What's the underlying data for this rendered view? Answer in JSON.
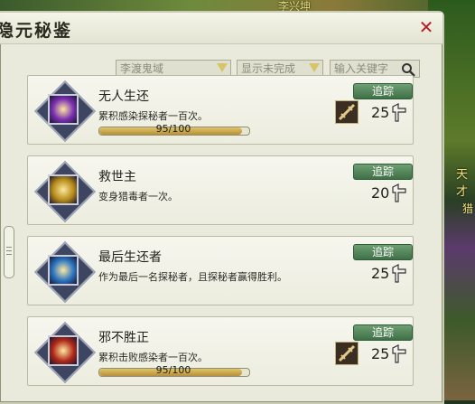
{
  "window": {
    "title": "隐元秘鉴"
  },
  "world": {
    "top_text": "李兴坤",
    "right_text": "天才",
    "right_text2": "猎"
  },
  "filters": {
    "map": "李渡鬼域",
    "status": "显示未完成",
    "search_placeholder": "输入关键字"
  },
  "track_label": "追踪",
  "achievements": [
    {
      "name": "无人生还",
      "desc": "累积感染探秘者一百次。",
      "progress_text": "95/100",
      "progress_fraction": 0.95,
      "points": "25",
      "has_progress": true,
      "has_item": true,
      "icon_color": "#7a2fb0"
    },
    {
      "name": "救世主",
      "desc": "变身猎毒者一次。",
      "progress_text": "",
      "progress_fraction": 0,
      "points": "20",
      "has_progress": false,
      "has_item": false,
      "icon_color": "#b48a18"
    },
    {
      "name": "最后生还者",
      "desc": "作为最后一名探秘者，且探秘者赢得胜利。",
      "progress_text": "",
      "progress_fraction": 0,
      "points": "25",
      "has_progress": false,
      "has_item": false,
      "icon_color": "#2a74c0"
    },
    {
      "name": "邪不胜正",
      "desc": "累积击败感染者一百次。",
      "progress_text": "95/100",
      "progress_fraction": 0.95,
      "points": "25",
      "has_progress": true,
      "has_item": true,
      "icon_color": "#b02818"
    }
  ]
}
